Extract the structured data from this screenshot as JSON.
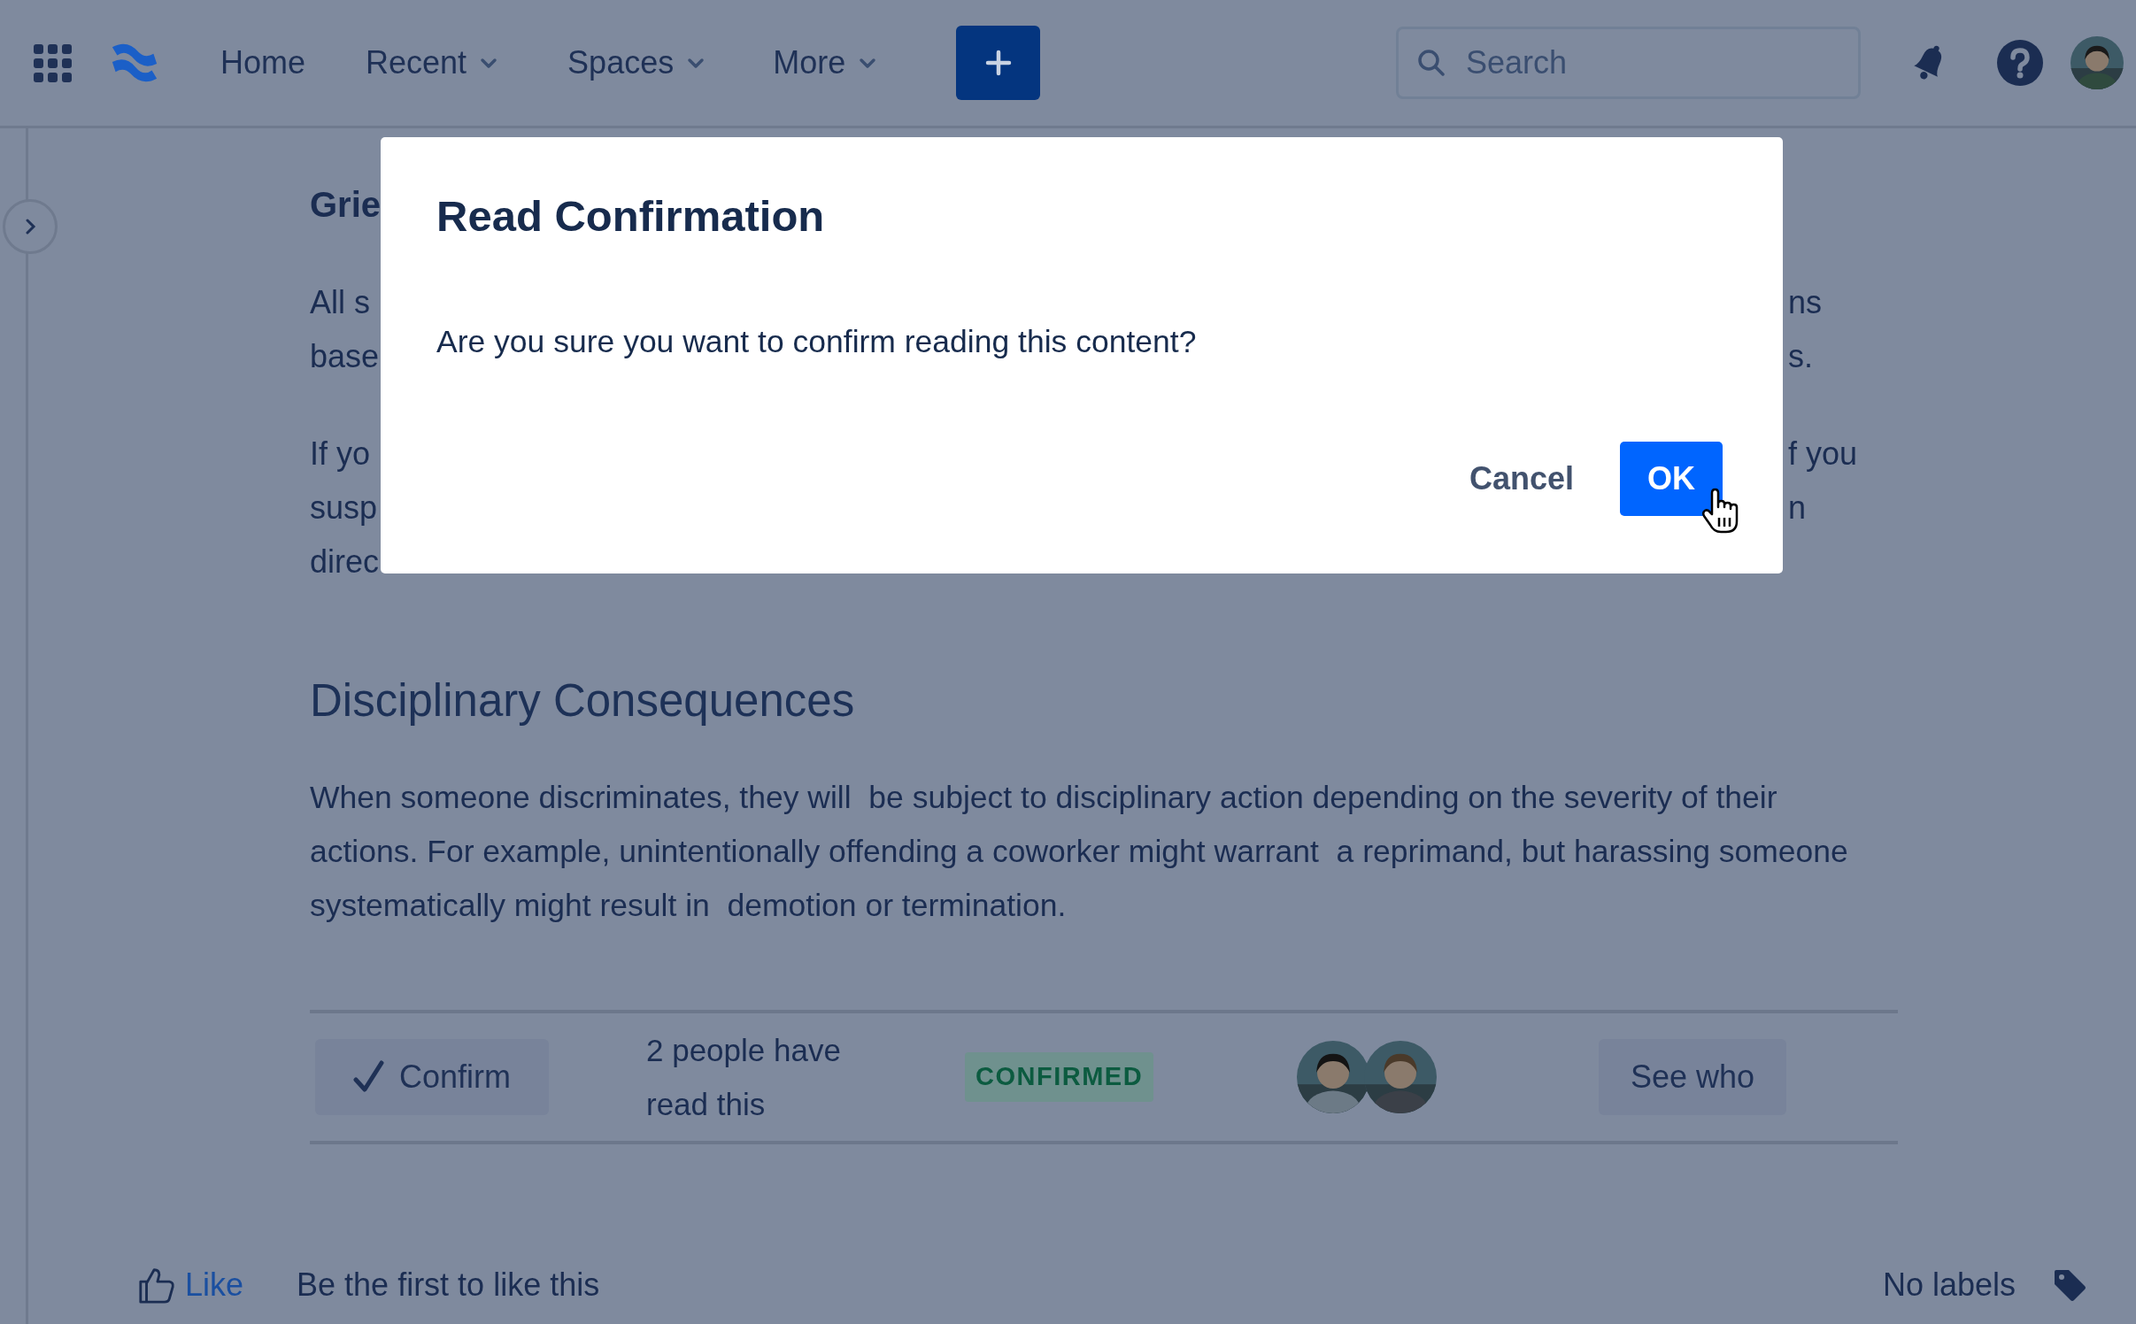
{
  "nav": {
    "items": [
      {
        "label": "Home",
        "dropdown": false
      },
      {
        "label": "Recent",
        "dropdown": true
      },
      {
        "label": "Spaces",
        "dropdown": true
      },
      {
        "label": "More",
        "dropdown": true
      }
    ],
    "search": {
      "placeholder": "Search"
    }
  },
  "covered_section": {
    "heading": "Grie",
    "left_paragraphs": [
      [
        "All s",
        "base"
      ],
      [
        "If yo",
        "susp",
        "direc"
      ]
    ],
    "right_paragraphs": [
      [
        "ns",
        "s."
      ],
      [
        "f you",
        "n"
      ]
    ]
  },
  "section": {
    "heading": "Disciplinary Consequences",
    "text": "When someone discriminates, they will  be subject to disciplinary action depending on the severity of their actions. For example, unintentionally offending a coworker might warrant  a reprimand, but harassing someone systematically might result in  demotion or termination."
  },
  "read_confirmation": {
    "button": "Confirm",
    "count_text": "2 people have read this",
    "status": "CONFIRMED",
    "see_who": "See who"
  },
  "footer": {
    "like": "Like",
    "like_text": "Be the first to like this",
    "labels": "No labels"
  },
  "dialog": {
    "title": "Read Confirmation",
    "message": "Are you sure you want to confirm reading this content?",
    "cancel": "Cancel",
    "ok": "OK"
  }
}
